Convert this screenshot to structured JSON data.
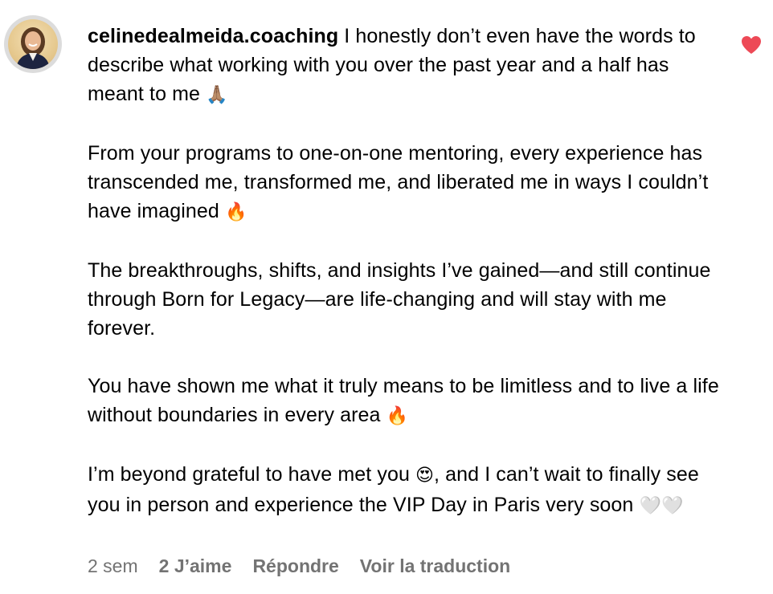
{
  "comment": {
    "username": "celinedealmeida.coaching",
    "paragraphs": [
      {
        "text": "I honestly don’t even have the words to describe what working with you over the past year and a half has meant to me",
        "emoji": "🙏🏽"
      },
      {
        "text": "From your programs to one-on-one mentoring, every experience has transcended me, transformed me, and liberated me in ways I couldn’t have imagined",
        "emoji": "🔥"
      },
      {
        "text": "The breakthroughs, shifts, and insights I’ve gained—and still continue through Born for Legacy—are life-changing and will stay with me forever.",
        "emoji": ""
      },
      {
        "text": "You have shown me what it truly means to be limitless and to live a life without boundaries in every area",
        "emoji": "🔥"
      },
      {
        "text_before": "I’m beyond grateful to have met you",
        "emoji_mid": "😍",
        "text_after": ", and I can’t wait to finally see you in person and experience the VIP Day in Paris very soon",
        "emoji_end": "🤍🤍"
      }
    ],
    "liked": true,
    "like_icon": "heart-icon",
    "accent_color": "#ed4956"
  },
  "actions": {
    "time": "2 sem",
    "likes": "2 J’aime",
    "reply": "Répondre",
    "translate": "Voir la traduction"
  }
}
